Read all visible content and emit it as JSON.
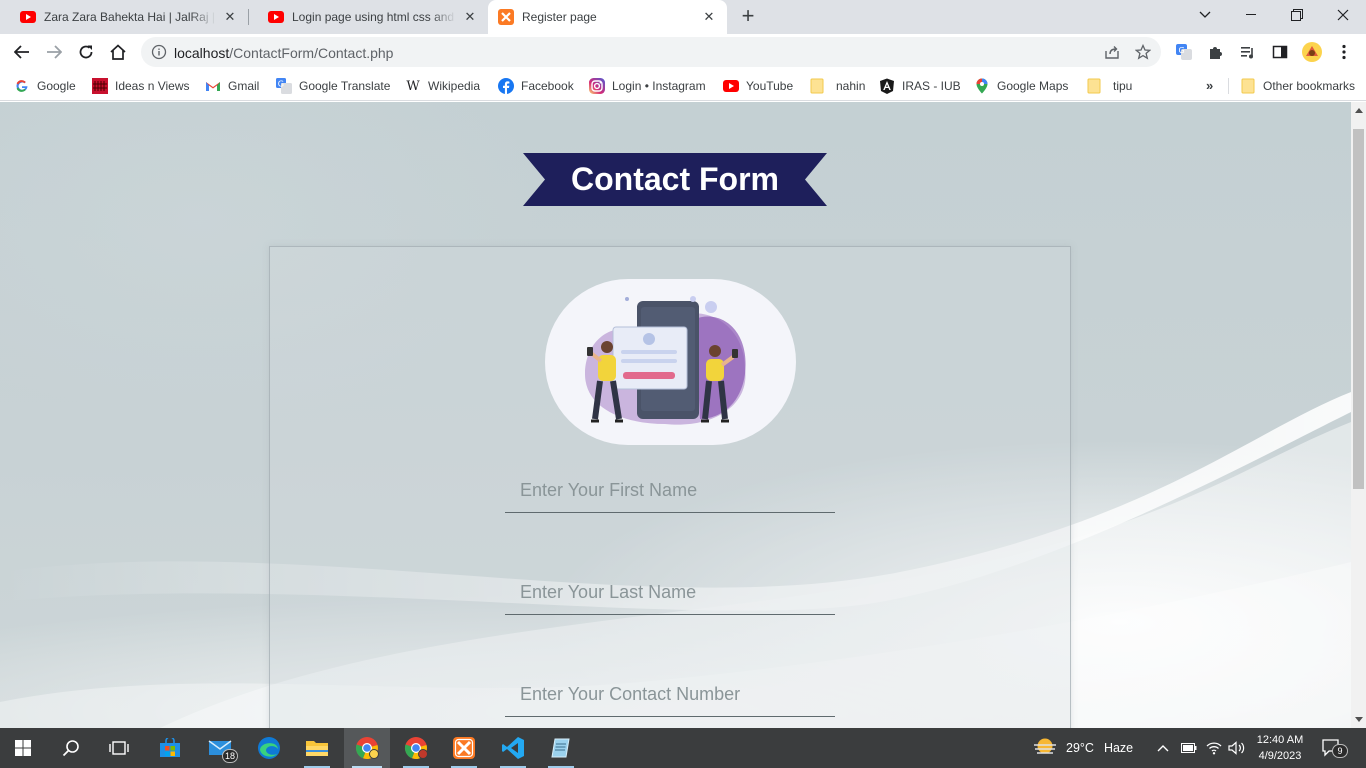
{
  "tabs": [
    {
      "title": "Zara Zara Bahekta Hai | JalRaj | RnB",
      "icon": "youtube-icon"
    },
    {
      "title": "Login page using html css and php",
      "icon": "youtube-icon"
    },
    {
      "title": "Register page",
      "icon": "xampp-icon"
    }
  ],
  "address_bar": {
    "host": "localhost",
    "path": "/ContactForm/Contact.php"
  },
  "bookmarks": [
    {
      "label": "Google",
      "icon": "google-icon"
    },
    {
      "label": "Ideas n Views",
      "icon": "ideas-n-views-icon"
    },
    {
      "label": "Gmail",
      "icon": "gmail-icon"
    },
    {
      "label": "Google Translate",
      "icon": "google-translate-icon"
    },
    {
      "label": "Wikipedia",
      "icon": "wikipedia-icon"
    },
    {
      "label": "Facebook",
      "icon": "facebook-icon"
    },
    {
      "label": "Login • Instagram",
      "icon": "instagram-icon"
    },
    {
      "label": "YouTube",
      "icon": "youtube-icon"
    },
    {
      "label": "nahin",
      "icon": "folder-icon"
    },
    {
      "label": "IRAS - IUB",
      "icon": "angular-icon"
    },
    {
      "label": "Google Maps",
      "icon": "google-maps-icon"
    },
    {
      "label": "tipu",
      "icon": "folder-icon"
    }
  ],
  "bookmarks_overflow": "»",
  "other_bookmarks": "Other bookmarks",
  "page": {
    "title": "Contact Form",
    "fields": [
      {
        "placeholder": "Enter Your First Name"
      },
      {
        "placeholder": "Enter Your Last Name"
      },
      {
        "placeholder": "Enter Your Contact Number"
      }
    ]
  },
  "taskbar": {
    "mail_badge": "18",
    "weather": {
      "temp": "29°C",
      "condition": "Haze"
    },
    "time": "12:40 AM",
    "date": "4/9/2023",
    "notification_count": "9"
  },
  "colors": {
    "ribbon": "#1e1f5b",
    "tabstrip": "#dee1e6",
    "taskbar": "#3b3d3e",
    "page_bg": "#c7d2d5"
  }
}
